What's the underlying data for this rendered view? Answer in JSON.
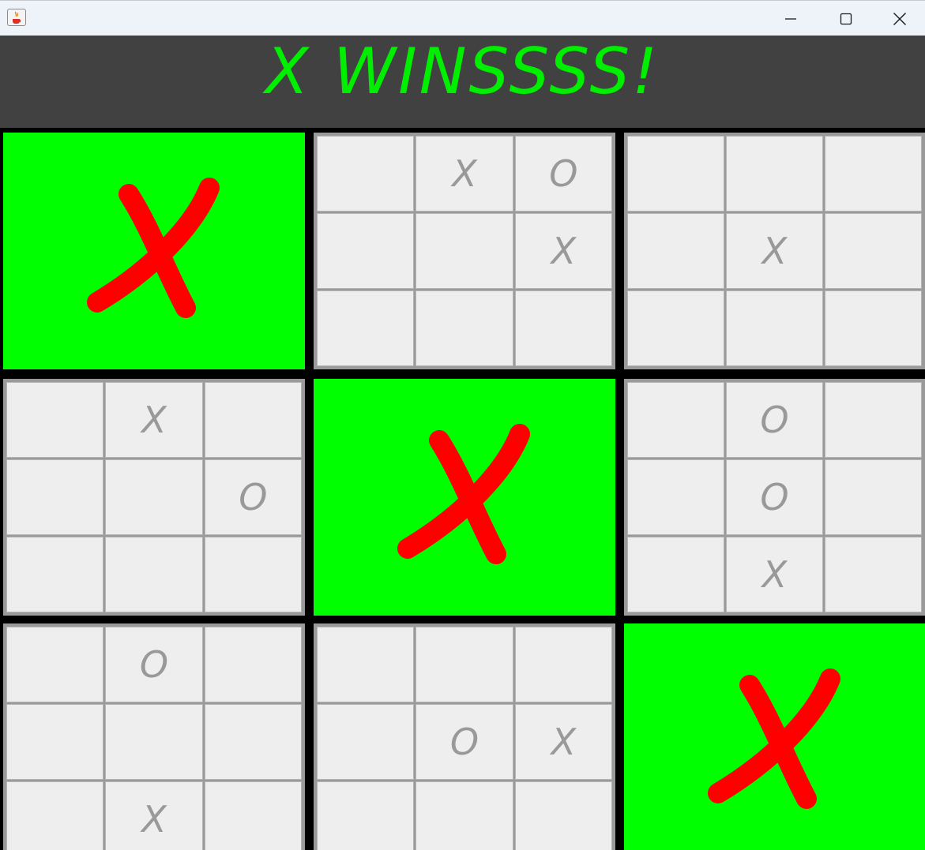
{
  "window": {
    "app_icon": "java-cup-icon",
    "controls": [
      "minimize-icon",
      "maximize-icon",
      "close-icon"
    ]
  },
  "banner": {
    "text": "X WINSSSS!",
    "color": "#00ee00"
  },
  "board": {
    "winner_mark_color": "#ff0000",
    "won_board_color": "#00ff00",
    "subboards": [
      {
        "status": "won",
        "winner": "X"
      },
      {
        "status": "open",
        "cells": [
          "",
          "X",
          "O",
          "",
          "",
          "X",
          "",
          "",
          ""
        ]
      },
      {
        "status": "open",
        "cells": [
          "",
          "",
          "",
          "",
          "X",
          "",
          "",
          "",
          ""
        ]
      },
      {
        "status": "open",
        "cells": [
          "",
          "X",
          "",
          "",
          "",
          "O",
          "",
          "",
          ""
        ]
      },
      {
        "status": "won",
        "winner": "X"
      },
      {
        "status": "open",
        "cells": [
          "",
          "O",
          "",
          "",
          "O",
          "",
          "",
          "X",
          ""
        ]
      },
      {
        "status": "open",
        "cells": [
          "",
          "O",
          "",
          "",
          "",
          "",
          "",
          "X",
          ""
        ]
      },
      {
        "status": "open",
        "cells": [
          "",
          "",
          "",
          "",
          "O",
          "X",
          "",
          "",
          ""
        ]
      },
      {
        "status": "won",
        "winner": "X"
      }
    ]
  }
}
